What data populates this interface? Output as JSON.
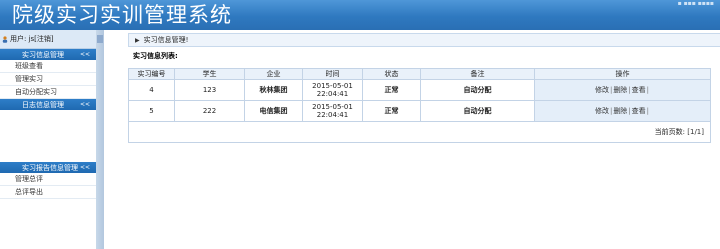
{
  "header": {
    "title": "院级实习实训管理系统",
    "top_links": "▪ ▪▪▪ ▪▪▪▪"
  },
  "sidebar": {
    "user_label": "用户: js[注销]",
    "section1": {
      "label": "实习信息管理",
      "arrow": "<<"
    },
    "section1_items": [
      "班级查看",
      "管理实习",
      "自动分配实习"
    ],
    "section2": {
      "label": "日志信息管理",
      "arrow": "<<"
    },
    "section3": {
      "label": "实习报告信息管理",
      "arrow": "<<"
    },
    "section3_items": [
      "管理总评",
      "总评导出"
    ]
  },
  "main": {
    "breadcrumb": "实习信息管理!",
    "list_title": "实习信息列表:",
    "columns": [
      "实习编号",
      "学生",
      "企业",
      "时间",
      "状态",
      "备注",
      "操作"
    ],
    "rows": [
      {
        "id": "4",
        "student": "123",
        "company": "秋林集团",
        "time1": "2015-05-01",
        "time2": "22:04:41",
        "status": "正常",
        "note": "自动分配",
        "op_edit": "修改",
        "op_delete": "删除",
        "op_view": "查看"
      },
      {
        "id": "5",
        "student": "222",
        "company": "电信集团",
        "time1": "2015-05-01",
        "time2": "22:04:41",
        "status": "正常",
        "note": "自动分配",
        "op_edit": "修改",
        "op_delete": "删除",
        "op_view": "查看"
      }
    ],
    "pager_label": "当前页数:",
    "pager_value": "[1/1]"
  }
}
